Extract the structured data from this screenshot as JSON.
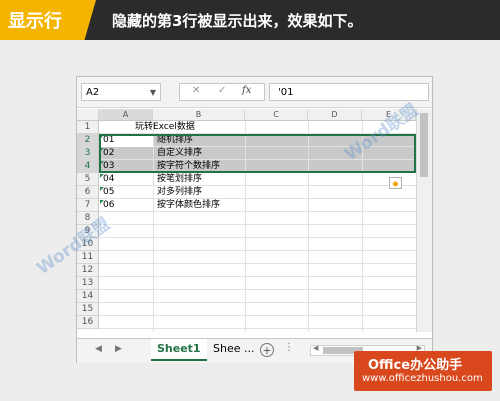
{
  "banner": {
    "tag": "显示行",
    "title": "隐藏的第3行被显示出来，效果如下。"
  },
  "formula_bar": {
    "name_box": "A2",
    "cancel": "✕",
    "enter": "✓",
    "fx": "fx",
    "value": "'01"
  },
  "columns": [
    "A",
    "B",
    "C",
    "D",
    "E"
  ],
  "rows": [
    "1",
    "2",
    "3",
    "4",
    "5",
    "6",
    "7",
    "8",
    "9",
    "10",
    "11",
    "12",
    "13",
    "14",
    "15",
    "16"
  ],
  "cells": {
    "b1": "玩转Excel数据",
    "a2": "01",
    "b2": "随机排序",
    "a3": "02",
    "b3": "自定义排序",
    "a4": "03",
    "b4": "按字符个数排序",
    "a5": "04",
    "b5": "按笔划排序",
    "a6": "05",
    "b6": "对多列排序",
    "a7": "06",
    "b7": "按字体颜色排序"
  },
  "sheet_tabs": {
    "active": "Sheet1",
    "second": "Shee ..."
  },
  "watermark": "Word联盟",
  "brand": {
    "name": "Office办公助手",
    "url": "www.officezhushou.com"
  },
  "colors": {
    "excel_green": "#217346",
    "banner_accent": "#f4b400",
    "brand_bg": "#d9481c"
  }
}
